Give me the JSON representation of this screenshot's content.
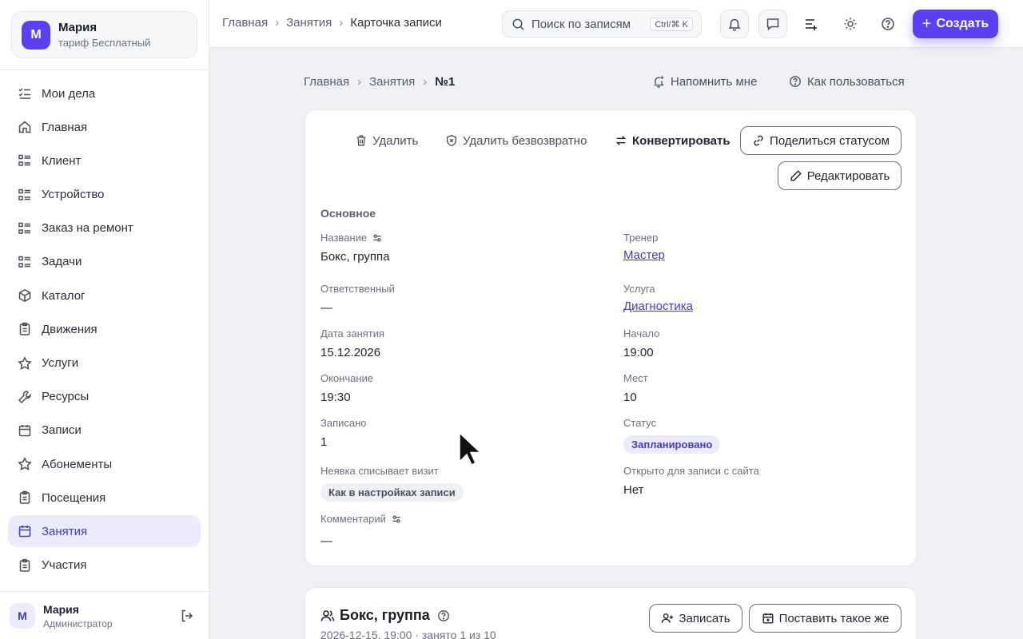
{
  "sidebar": {
    "profile": {
      "initial": "М",
      "name": "Мария",
      "plan": "тариф Бесплатный"
    },
    "items": [
      {
        "label": "Мои дела",
        "icon": "checklist-icon"
      },
      {
        "label": "Главная",
        "icon": "home-icon"
      },
      {
        "label": "Клиент",
        "icon": "list-icon"
      },
      {
        "label": "Устройство",
        "icon": "list-icon"
      },
      {
        "label": "Заказ на ремонт",
        "icon": "list-icon"
      },
      {
        "label": "Задачи",
        "icon": "list-icon"
      },
      {
        "label": "Каталог",
        "icon": "cube-icon"
      },
      {
        "label": "Движения",
        "icon": "clipboard-icon"
      },
      {
        "label": "Услуги",
        "icon": "star-icon"
      },
      {
        "label": "Ресурсы",
        "icon": "wrench-icon"
      },
      {
        "label": "Записи",
        "icon": "calendar-icon"
      },
      {
        "label": "Абонементы",
        "icon": "star-icon"
      },
      {
        "label": "Посещения",
        "icon": "clipboard-icon"
      },
      {
        "label": "Занятия",
        "icon": "calendar-icon",
        "active": true
      },
      {
        "label": "Участия",
        "icon": "clipboard-icon"
      }
    ],
    "user": {
      "initial": "М",
      "name": "Мария",
      "role": "Администратор"
    }
  },
  "topbar": {
    "breadcrumb": [
      "Главная",
      "Занятия",
      "Карточка записи"
    ],
    "search": {
      "placeholder": "Поиск по записям",
      "shortcut": "Ctrl/⌘ K"
    },
    "create_label": "Создать"
  },
  "page": {
    "breadcrumb": [
      "Главная",
      "Занятия",
      "№1"
    ],
    "remind_label": "Напомнить мне",
    "howto_label": "Как пользоваться"
  },
  "card": {
    "actions": {
      "delete": "Удалить",
      "delete_forever": "Удалить безвозвратно",
      "convert": "Конвертировать",
      "share": "Поделиться статусом",
      "edit": "Редактировать"
    },
    "section": "Основное",
    "fields": {
      "name": {
        "label": "Название",
        "value": "Бокс, группа"
      },
      "trainer": {
        "label": "Тренер",
        "value": "Мастер"
      },
      "responsible": {
        "label": "Ответственный",
        "value": "—"
      },
      "service": {
        "label": "Услуга",
        "value": "Диагностика"
      },
      "date": {
        "label": "Дата занятия",
        "value": "15.12.2026"
      },
      "start": {
        "label": "Начало",
        "value": "19:00"
      },
      "end": {
        "label": "Окончание",
        "value": "19:30"
      },
      "seats": {
        "label": "Мест",
        "value": "10"
      },
      "enrolled": {
        "label": "Записано",
        "value": "1"
      },
      "status": {
        "label": "Статус",
        "value": "Запланировано"
      },
      "noshow": {
        "label": "Неявка списывает визит",
        "value": "Как в настройках записи"
      },
      "open_site": {
        "label": "Открыто для записи с сайта",
        "value": "Нет"
      },
      "comment": {
        "label": "Комментарий",
        "value": "—"
      }
    }
  },
  "card2": {
    "title": "Бокс, группа",
    "subtitle": "2026-12-15, 19:00 · занято 1 из 10",
    "enroll_label": "Записать",
    "repeat_label": "Поставить такое же"
  },
  "colors": {
    "accent": "#5b3ff0",
    "accent_soft": "#ecebfd",
    "link": "#4338ca"
  }
}
